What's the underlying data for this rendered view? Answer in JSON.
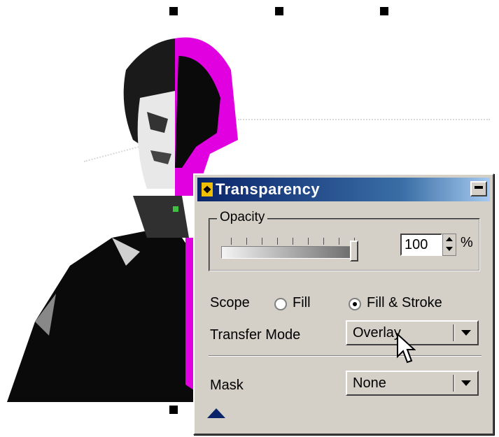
{
  "panel": {
    "title": "Transparency",
    "opacity": {
      "group_label": "Opacity",
      "value": "100",
      "unit": "%",
      "slider_level": 1.0
    },
    "scope": {
      "label": "Scope",
      "options": [
        "Fill",
        "Fill & Stroke"
      ],
      "selected": "Fill & Stroke"
    },
    "transfer_mode": {
      "label": "Transfer Mode",
      "value": "Overlay"
    },
    "mask": {
      "label": "Mask",
      "value": "None"
    }
  },
  "colors": {
    "title_bar": "#0a246a",
    "panel_bg": "#d4d0c8",
    "artwork_highlight": "#e000e0"
  }
}
